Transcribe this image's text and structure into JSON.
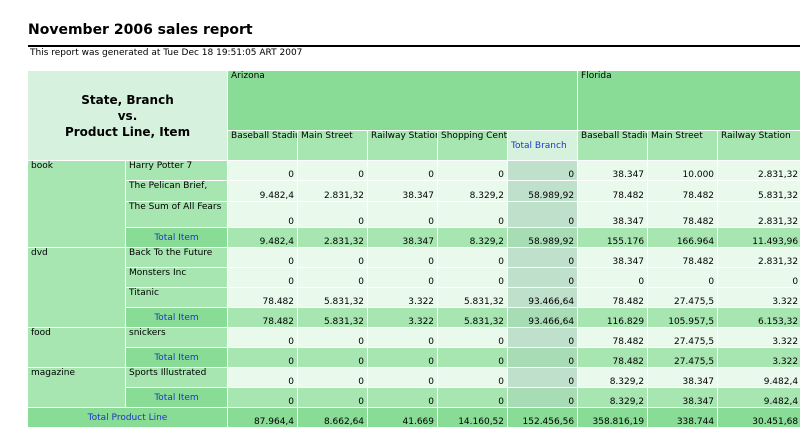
{
  "header": {
    "title": "November 2006 sales report",
    "subtitle": "This report was generated at Tue Dec 18 19:51:05 ART 2007"
  },
  "corner": {
    "line1": "State, Branch",
    "line2": "vs.",
    "line3": "Product Line, Item"
  },
  "states": {
    "arizona": "Arizona",
    "florida": "Florida"
  },
  "branches": {
    "az_baseball": "Baseball Stadium",
    "az_main": "Main Street",
    "az_railway": "Railway Station",
    "az_shopping": "Shopping Center",
    "az_total": "Total Branch",
    "fl_baseball": "Baseball Stadium",
    "fl_main": "Main Street",
    "fl_railway": "Railway Station"
  },
  "product_lines": {
    "book": "book",
    "dvd": "dvd",
    "food": "food",
    "magazine": "magazine"
  },
  "items": {
    "harry": "Harry Potter 7",
    "pelican": "The Pelican Brief,",
    "sumofall": "The Sum of All Fears",
    "backfuture": "Back To the Future",
    "monsters": "Monsters Inc",
    "titanic": "Titanic",
    "snickers": "snickers",
    "sports": "Sports Illustrated"
  },
  "labels": {
    "total_item": "Total Item",
    "total_product_line": "Total Product Line"
  },
  "values": {
    "harry": [
      "0",
      "0",
      "0",
      "0",
      "0",
      "38.347",
      "10.000",
      "2.831,32"
    ],
    "pelican": [
      "9.482,4",
      "2.831,32",
      "38.347",
      "8.329,2",
      "58.989,92",
      "78.482",
      "78.482",
      "5.831,32"
    ],
    "sumofall": [
      "0",
      "0",
      "0",
      "0",
      "0",
      "38.347",
      "78.482",
      "2.831,32"
    ],
    "book_total": [
      "9.482,4",
      "2.831,32",
      "38.347",
      "8.329,2",
      "58.989,92",
      "155.176",
      "166.964",
      "11.493,96"
    ],
    "backfuture": [
      "0",
      "0",
      "0",
      "0",
      "0",
      "38.347",
      "78.482",
      "2.831,32"
    ],
    "monsters": [
      "0",
      "0",
      "0",
      "0",
      "0",
      "0",
      "0",
      "0"
    ],
    "titanic": [
      "78.482",
      "5.831,32",
      "3.322",
      "5.831,32",
      "93.466,64",
      "78.482",
      "27.475,5",
      "3.322"
    ],
    "dvd_total": [
      "78.482",
      "5.831,32",
      "3.322",
      "5.831,32",
      "93.466,64",
      "116.829",
      "105.957,5",
      "6.153,32"
    ],
    "snickers": [
      "0",
      "0",
      "0",
      "0",
      "0",
      "78.482",
      "27.475,5",
      "3.322"
    ],
    "food_total": [
      "0",
      "0",
      "0",
      "0",
      "0",
      "78.482",
      "27.475,5",
      "3.322"
    ],
    "sports": [
      "0",
      "0",
      "0",
      "0",
      "0",
      "8.329,2",
      "38.347",
      "9.482,4"
    ],
    "mag_total": [
      "0",
      "0",
      "0",
      "0",
      "0",
      "8.329,2",
      "38.347",
      "9.482,4"
    ],
    "grand_total": [
      "87.964,4",
      "8.662,64",
      "41.669",
      "14.160,52",
      "152.456,56",
      "358.816,19",
      "338.744",
      "30.451,68"
    ]
  }
}
